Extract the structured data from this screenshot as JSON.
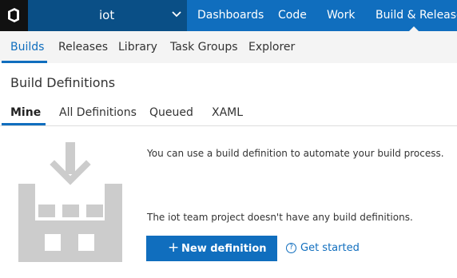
{
  "colors": {
    "accent": "#106ebe",
    "topbar": "#106ebe",
    "project_selector": "#0a4f86",
    "logo_bg": "#111111",
    "illustration": "#cccccc"
  },
  "topbar": {
    "logo_icon": "vsts-logo-icon",
    "project": {
      "name": "iot",
      "dropdown_icon": "chevron-down-icon"
    },
    "nav": [
      {
        "label": "Dashboards"
      },
      {
        "label": "Code"
      },
      {
        "label": "Work"
      },
      {
        "label": "Build & Release",
        "selected": true
      }
    ]
  },
  "subnav": {
    "items": [
      {
        "label": "Builds",
        "selected": true
      },
      {
        "label": "Releases"
      },
      {
        "label": "Library"
      },
      {
        "label": "Task Groups"
      },
      {
        "label": "Explorer"
      }
    ]
  },
  "page": {
    "title": "Build Definitions",
    "pivots": [
      {
        "label": "Mine",
        "selected": true
      },
      {
        "label": "All Definitions"
      },
      {
        "label": "Queued"
      },
      {
        "label": "XAML"
      }
    ]
  },
  "empty_state": {
    "illustration_icon": "build-definition-illustration-icon",
    "intro": "You can use a build definition to automate your build process.",
    "no_definitions": "The iot team project doesn't have any build definitions.",
    "new_button": {
      "icon": "+",
      "label": "New definition"
    },
    "help": {
      "icon": "?",
      "label": "Get started"
    }
  }
}
